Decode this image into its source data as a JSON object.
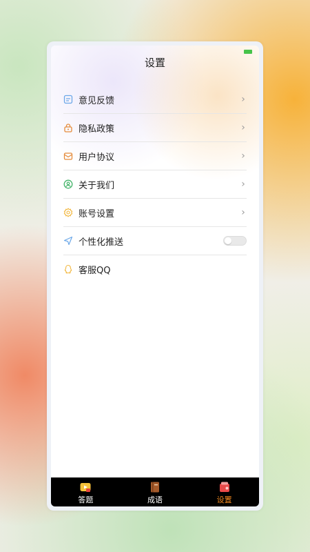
{
  "title": "设置",
  "menu": [
    {
      "label": "意见反馈",
      "icon": "feedback-icon",
      "color": "#6aa7e8",
      "chevron": true
    },
    {
      "label": "隐私政策",
      "icon": "lock-icon",
      "color": "#e58b3a",
      "chevron": true
    },
    {
      "label": "用户协议",
      "icon": "agreement-icon",
      "color": "#e58b3a",
      "chevron": true
    },
    {
      "label": "关于我们",
      "icon": "user-circle-icon",
      "color": "#45b46a",
      "chevron": true
    },
    {
      "label": "账号设置",
      "icon": "gear-icon",
      "color": "#f2b63c",
      "chevron": true
    },
    {
      "label": "个性化推送",
      "icon": "send-icon",
      "color": "#6aa7e8",
      "toggle": true,
      "toggle_on": false
    },
    {
      "label": "客服QQ",
      "icon": "qq-icon",
      "color": "#f2b63c"
    }
  ],
  "tabbar": [
    {
      "label": "答题",
      "icon": "quiz-icon",
      "active": false
    },
    {
      "label": "成语",
      "icon": "book-icon",
      "active": false
    },
    {
      "label": "设置",
      "icon": "settings-tab-icon",
      "active": true
    }
  ],
  "colors": {
    "accent": "#f58a1f",
    "tabbar_bg": "#000000"
  }
}
